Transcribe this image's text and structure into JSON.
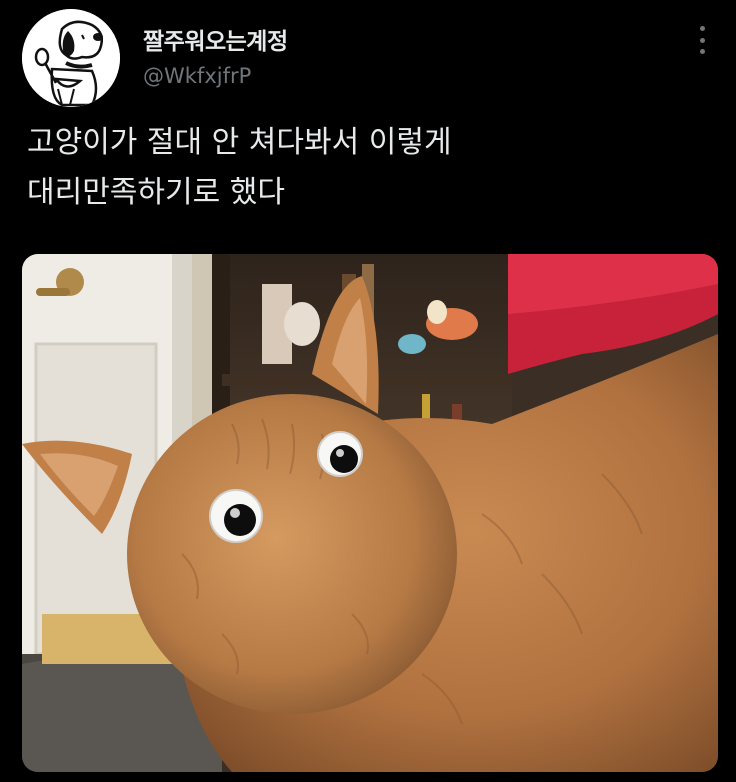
{
  "author": {
    "display_name": "짤주워오는계정",
    "handle": "@WkfxjfrP",
    "avatar_icon": "snoopy-avatar-icon"
  },
  "tweet": {
    "text": "고양이가 절대 안 쳐다봐서 이렇게\n대리만족하기로 했다"
  },
  "menu": {
    "icon": "more-options-icon"
  },
  "colors": {
    "background": "#000000",
    "text_primary": "#e7e9ea",
    "text_secondary": "#71767b"
  }
}
